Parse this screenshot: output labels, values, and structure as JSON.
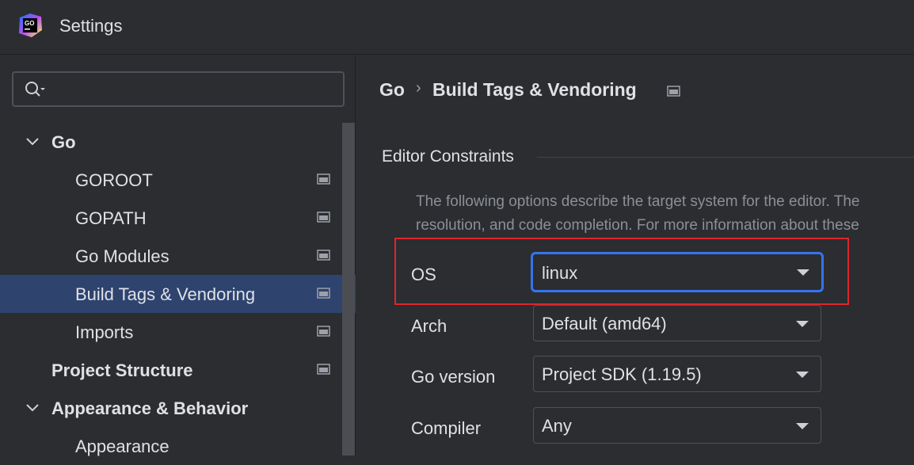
{
  "window": {
    "title": "Settings",
    "logo_icon": "goland-logo-icon"
  },
  "sidebar": {
    "search": {
      "value": "",
      "placeholder": ""
    },
    "items": [
      {
        "label": "Go",
        "level": 0,
        "expanded": true,
        "bold": true
      },
      {
        "label": "GOROOT",
        "level": 1,
        "project_icon": true
      },
      {
        "label": "GOPATH",
        "level": 1,
        "project_icon": true
      },
      {
        "label": "Go Modules",
        "level": 1,
        "project_icon": true
      },
      {
        "label": "Build Tags & Vendoring",
        "level": 1,
        "project_icon": true,
        "selected": true
      },
      {
        "label": "Imports",
        "level": 1,
        "project_icon": true
      },
      {
        "label": "Project Structure",
        "level": 0,
        "bold": true,
        "project_icon": true
      },
      {
        "label": "Appearance & Behavior",
        "level": 0,
        "expanded": true,
        "bold": true
      },
      {
        "label": "Appearance",
        "level": 1
      }
    ]
  },
  "main": {
    "breadcrumb": {
      "parent": "Go",
      "separator": "›",
      "current": "Build Tags & Vendoring"
    },
    "section_title": "Editor Constraints",
    "description_line1": "The following options describe the target system for the editor. The",
    "description_line2": "resolution, and code completion. For more information about these",
    "fields": [
      {
        "label": "OS",
        "value": "linux",
        "focused": true
      },
      {
        "label": "Arch",
        "value": "Default (amd64)"
      },
      {
        "label": "Go version",
        "value": "Project SDK (1.19.5)"
      },
      {
        "label": "Compiler",
        "value": "Any"
      }
    ]
  },
  "colors": {
    "background": "#2b2d30",
    "selection": "#2e436e",
    "focus_border": "#3574f0",
    "highlight_annotation": "#e0252b"
  }
}
